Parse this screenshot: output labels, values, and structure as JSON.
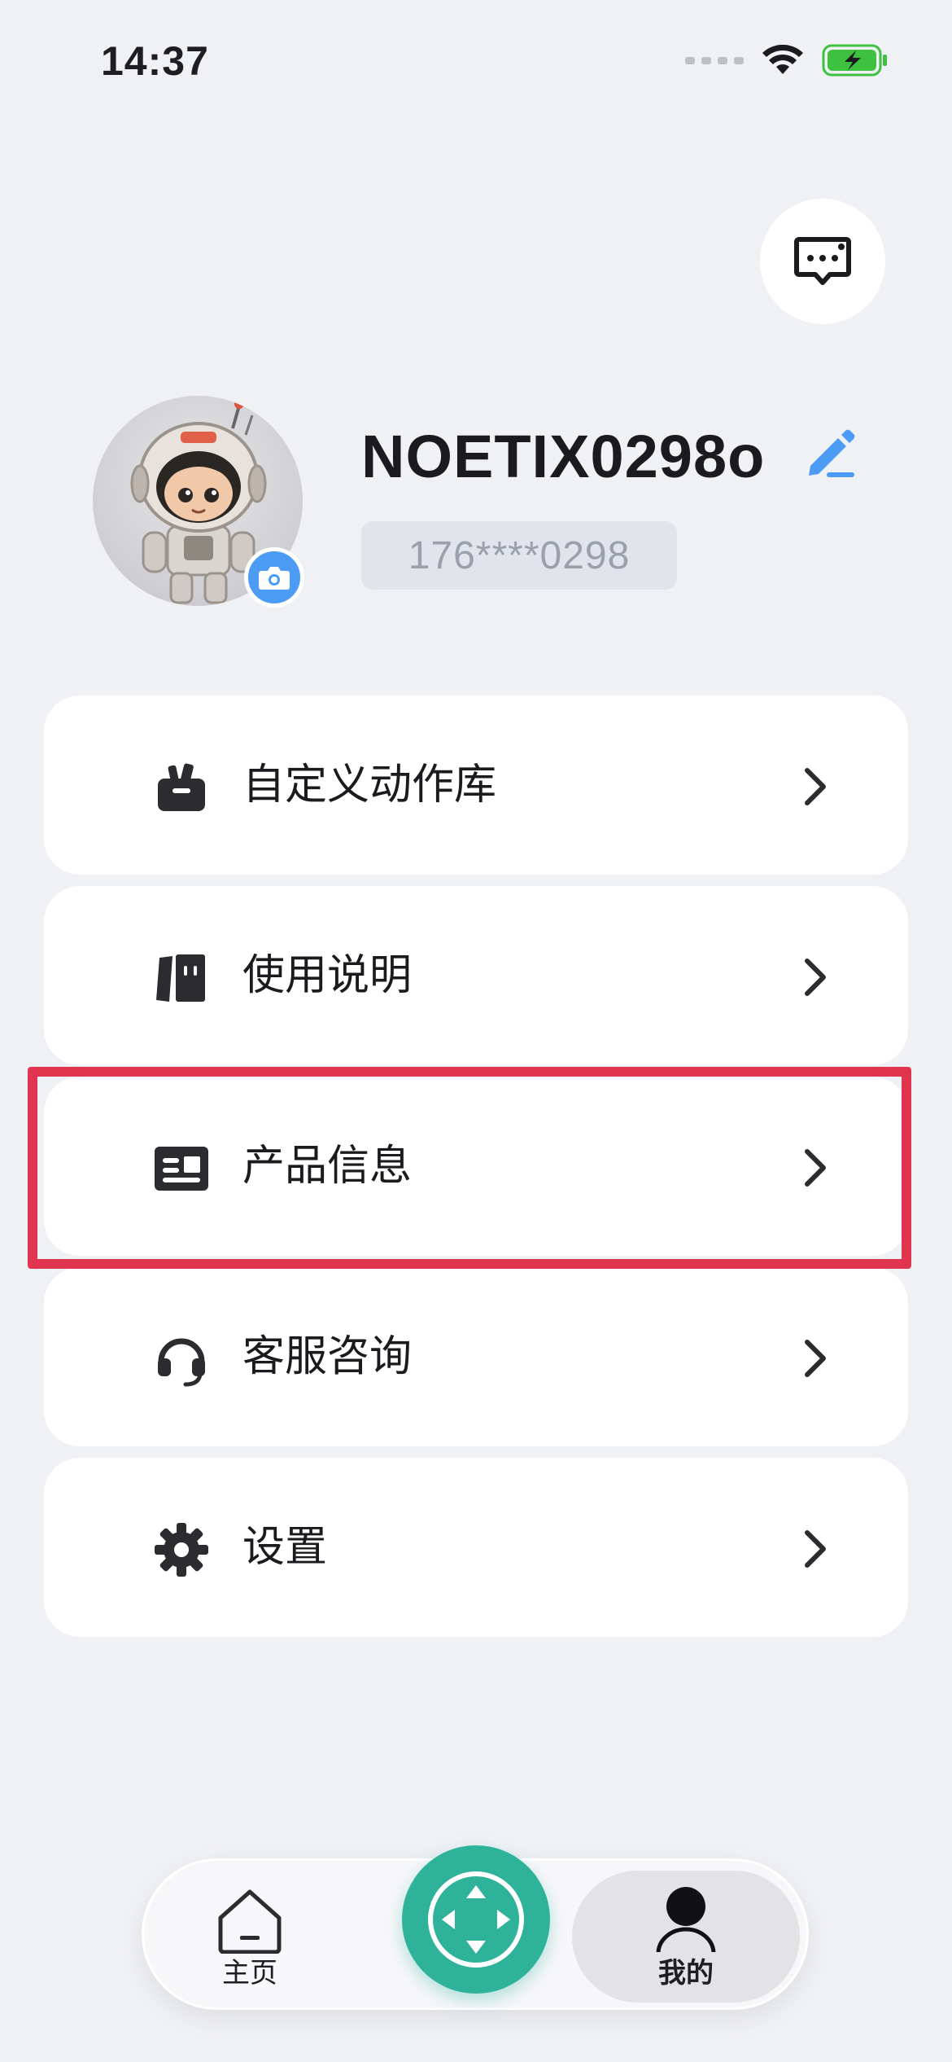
{
  "status_bar": {
    "time": "14:37"
  },
  "profile": {
    "username": "NOETIX0298o",
    "phone": "176****0298"
  },
  "menu": [
    {
      "label": "自定义动作库",
      "icon": "bag-icon"
    },
    {
      "label": "使用说明",
      "icon": "book-icon"
    },
    {
      "label": "产品信息",
      "icon": "id-card-icon"
    },
    {
      "label": "客服咨询",
      "icon": "headset-icon"
    },
    {
      "label": "设置",
      "icon": "gear-icon"
    }
  ],
  "tab_bar": {
    "home_label": "主页",
    "mine_label": "我的"
  },
  "colors": {
    "background": "#f0f1f5",
    "accent_blue": "#4c9bf5",
    "fab_green": "#2eb39a",
    "highlight_red": "#e0344f"
  }
}
